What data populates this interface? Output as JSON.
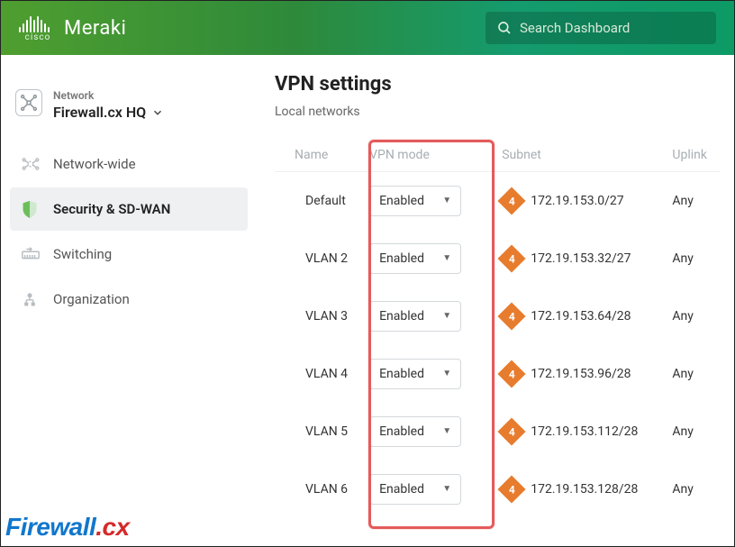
{
  "brand": {
    "cisco": "cisco",
    "product": "Meraki"
  },
  "search": {
    "placeholder": "Search Dashboard"
  },
  "network_selector": {
    "label": "Network",
    "name": "Firewall.cx HQ"
  },
  "nav": {
    "items": [
      {
        "label": "Network-wide"
      },
      {
        "label": "Security & SD-WAN"
      },
      {
        "label": "Switching"
      },
      {
        "label": "Organization"
      }
    ],
    "active_index": 1
  },
  "page": {
    "title": "VPN settings",
    "section": "Local networks",
    "columns": {
      "name": "Name",
      "mode": "VPN mode",
      "subnet": "Subnet",
      "uplink": "Uplink"
    },
    "badge_version": "4",
    "rows": [
      {
        "name": "Default",
        "mode": "Enabled",
        "subnet": "172.19.153.0/27",
        "uplink": "Any"
      },
      {
        "name": "VLAN 2",
        "mode": "Enabled",
        "subnet": "172.19.153.32/27",
        "uplink": "Any"
      },
      {
        "name": "VLAN 3",
        "mode": "Enabled",
        "subnet": "172.19.153.64/28",
        "uplink": "Any"
      },
      {
        "name": "VLAN 4",
        "mode": "Enabled",
        "subnet": "172.19.153.96/28",
        "uplink": "Any"
      },
      {
        "name": "VLAN 5",
        "mode": "Enabled",
        "subnet": "172.19.153.112/28",
        "uplink": "Any"
      },
      {
        "name": "VLAN 6",
        "mode": "Enabled",
        "subnet": "172.19.153.128/28",
        "uplink": "Any"
      }
    ]
  },
  "watermark": {
    "part1": "Firewall",
    "part2": ".cx"
  }
}
